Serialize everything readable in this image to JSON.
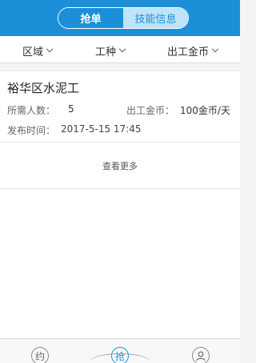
{
  "header": {
    "tabs": [
      {
        "label": "抢单",
        "active": true
      },
      {
        "label": "技能信息",
        "active": false
      }
    ]
  },
  "filters": [
    {
      "label": "区域"
    },
    {
      "label": "工种"
    },
    {
      "label": "出工金币"
    }
  ],
  "job": {
    "title": "裕华区水泥工",
    "people_label": "所需人数：",
    "people_value": "5",
    "coins_label": "出工金币：",
    "coins_value": "100金币/天",
    "time_label": "发布时间：",
    "time_value": "2017-5-15 17:45"
  },
  "more_label": "查看更多",
  "tabbar": [
    {
      "icon_char": "约"
    },
    {
      "icon_char": "抢"
    },
    {
      "icon": "user-icon"
    }
  ],
  "colors": {
    "accent": "#1d8fd8"
  }
}
